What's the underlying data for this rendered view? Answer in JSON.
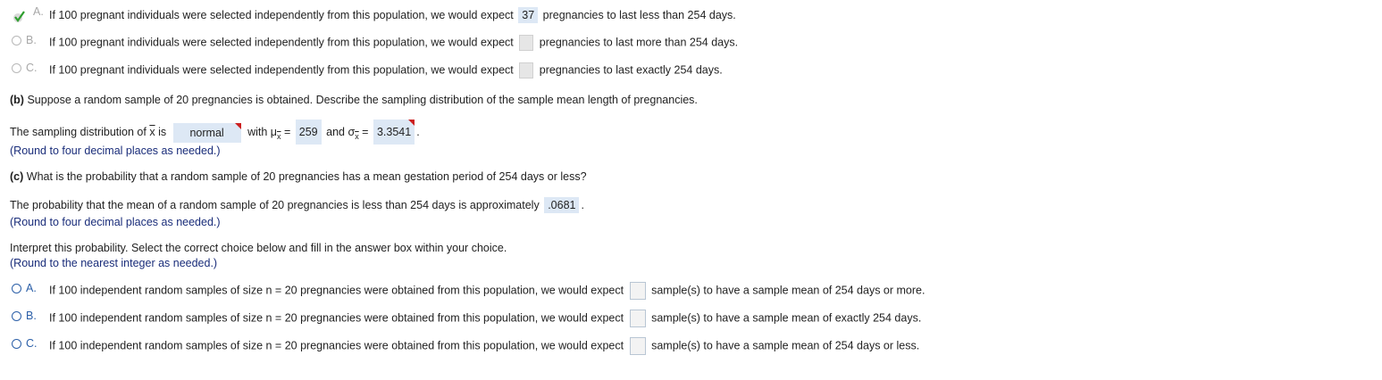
{
  "part_a_options": [
    {
      "letter": "A.",
      "pre": "If 100 pregnant individuals were selected independently from this population, we would expect",
      "answer": "37",
      "post": "pregnancies to last less than 254 days."
    },
    {
      "letter": "B.",
      "pre": "If 100 pregnant individuals were selected independently from this population, we would expect",
      "answer": "",
      "post": "pregnancies to last more than 254 days."
    },
    {
      "letter": "C.",
      "pre": "If 100 pregnant individuals were selected independently from this population, we would expect",
      "answer": "",
      "post": "pregnancies to last exactly 254 days."
    }
  ],
  "part_b": {
    "label": "(b)",
    "question": "Suppose a random sample of 20 pregnancies is obtained. Describe the sampling distribution of the sample mean length of pregnancies.",
    "sentence_pre": "The sampling distribution of",
    "xbar": "x",
    "is": "is",
    "dropdown_value": "normal",
    "with": "with",
    "mu": "μ",
    "eq1": "=",
    "mu_value": "259",
    "and": "and",
    "sigma": "σ",
    "eq2": "=",
    "sigma_value": "3.3541",
    "end": ".",
    "note": "(Round to four decimal places as needed.)"
  },
  "part_c": {
    "label": "(c)",
    "question": "What is the probability that a random sample of 20 pregnancies has a mean gestation period of 254 days or less?",
    "sentence_pre": "The probability that the mean of a random sample of 20 pregnancies is less than 254 days is approximately",
    "probability": ".0681",
    "end": ".",
    "note": "(Round to four decimal places as needed.)",
    "interpret": "Interpret this probability. Select the correct choice below and fill in the answer box within your choice.",
    "interpret_note": "(Round to the nearest integer as needed.)"
  },
  "part_c_options": [
    {
      "letter": "A.",
      "pre": "If 100 independent random samples of size n = 20 pregnancies were obtained from this population, we would expect",
      "post": "sample(s) to have a sample mean of 254 days or more."
    },
    {
      "letter": "B.",
      "pre": "If 100 independent random samples of size n = 20 pregnancies were obtained from this population, we would expect",
      "post": "sample(s) to have a sample mean of exactly 254 days."
    },
    {
      "letter": "C.",
      "pre": "If 100 independent random samples of size n = 20 pregnancies were obtained from this population, we would expect",
      "post": "sample(s) to have a sample mean of 254 days or less."
    }
  ],
  "colors": {
    "accent": "#2b5fa8",
    "answer_bg": "#dde8f5",
    "note": "#1a2d7a",
    "check_green": "#2e9e2e",
    "flag_red": "#cc1f1f"
  },
  "icons": {
    "selected": "checkmark-icon",
    "radio": "radio-circle-icon",
    "flag": "red-corner-flag-icon"
  }
}
